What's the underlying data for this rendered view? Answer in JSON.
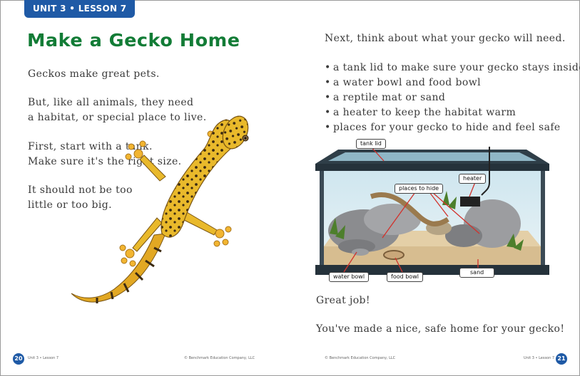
{
  "header": {
    "unit_tab": "UNIT 3 • LESSON 7"
  },
  "left": {
    "title": "Make a Gecko Home",
    "p1": "Geckos make great pets.",
    "p2_line1": "But, like all animals, they need",
    "p2_line2": "a habitat, or special place to live.",
    "p3_line1": "First, start with a tank.",
    "p3_line2": "Make sure it's the right size.",
    "p4_line1": "It should not be too",
    "p4_line2": "little or too big."
  },
  "right": {
    "intro": "Next, think about what your gecko will need.",
    "bullets": [
      "a tank lid to make sure your gecko stays inside",
      "a water bowl and food bowl",
      "a reptile mat or sand",
      "a heater to keep the habitat warm",
      "places for your gecko to hide and feel safe"
    ],
    "labels": {
      "tank_lid": "tank lid",
      "heater": "heater",
      "places_to_hide": "places to hide",
      "water_bowl": "water bowl",
      "food_bowl": "food bowl",
      "sand": "sand"
    },
    "outro1": "Great job!",
    "outro2": "You've made a nice, safe home for your gecko!"
  },
  "footer": {
    "left_page_num": "20",
    "left_unit": "Unit 3 • Lesson 7",
    "left_copyright": "© Benchmark Education Company, LLC",
    "right_copyright": "© Benchmark Education Company, LLC",
    "right_unit": "Unit 3 • Lesson 7",
    "right_page_num": "21"
  },
  "colors": {
    "accent_blue": "#1f5aa6",
    "title_green": "#127c36",
    "gecko_yellow": "#e9b92b"
  }
}
